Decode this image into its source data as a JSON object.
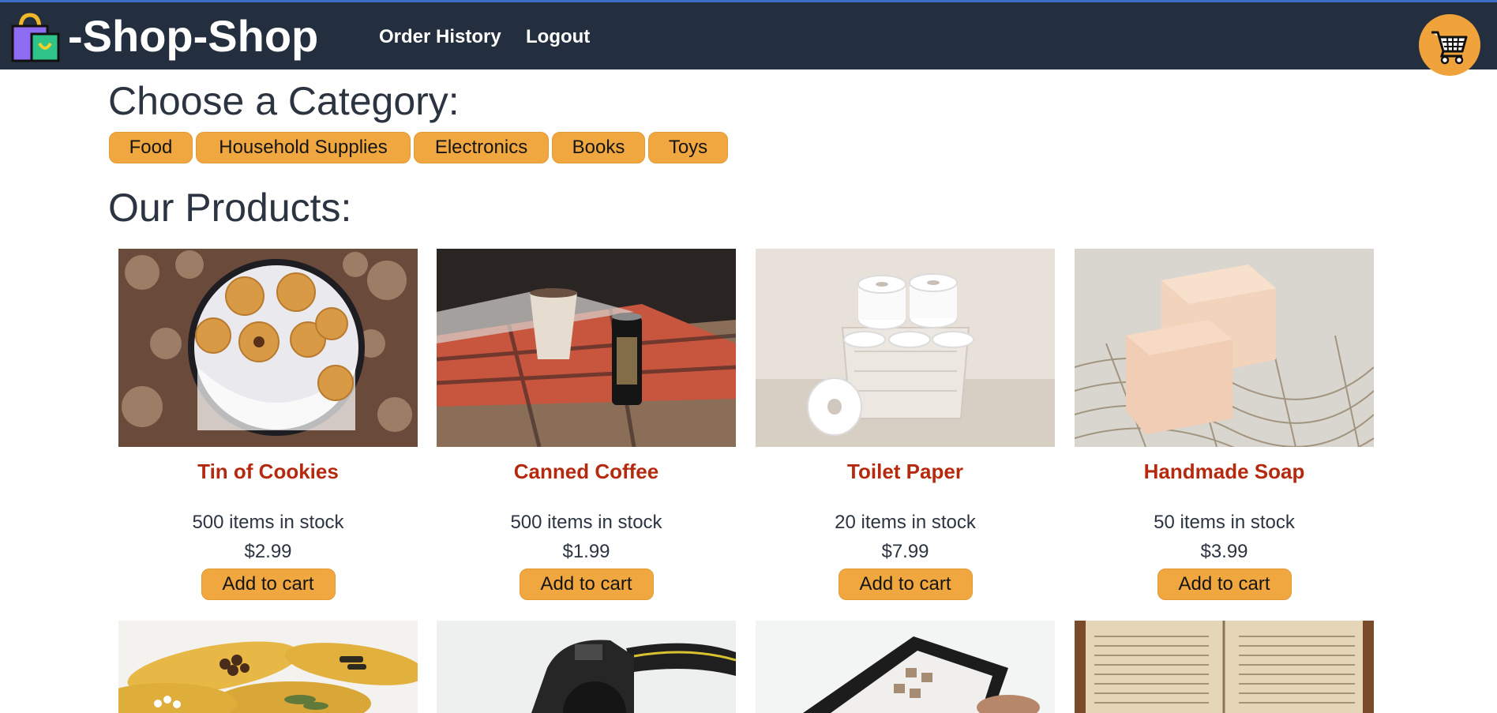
{
  "header": {
    "brand": "-Shop-Shop",
    "nav": [
      "Order History",
      "Logout"
    ],
    "cart_icon": "shopping-cart-icon",
    "logo_icon": "shopping-bag-icon"
  },
  "categories": {
    "title": "Choose a Category:",
    "items": [
      "Food",
      "Household Supplies",
      "Electronics",
      "Books",
      "Toys"
    ]
  },
  "products": {
    "title": "Our Products:",
    "add_label": "Add to cart",
    "items": [
      {
        "name": "Tin of Cookies",
        "stock": "500 items in stock",
        "price": "$2.99"
      },
      {
        "name": "Canned Coffee",
        "stock": "500 items in stock",
        "price": "$1.99"
      },
      {
        "name": "Toilet Paper",
        "stock": "20 items in stock",
        "price": "$7.99"
      },
      {
        "name": "Handmade Soap",
        "stock": "50 items in stock",
        "price": "$3.99"
      }
    ]
  },
  "colors": {
    "header_bg": "#232f3e",
    "accent": "#f0a740",
    "product_name": "#b52a0f"
  }
}
